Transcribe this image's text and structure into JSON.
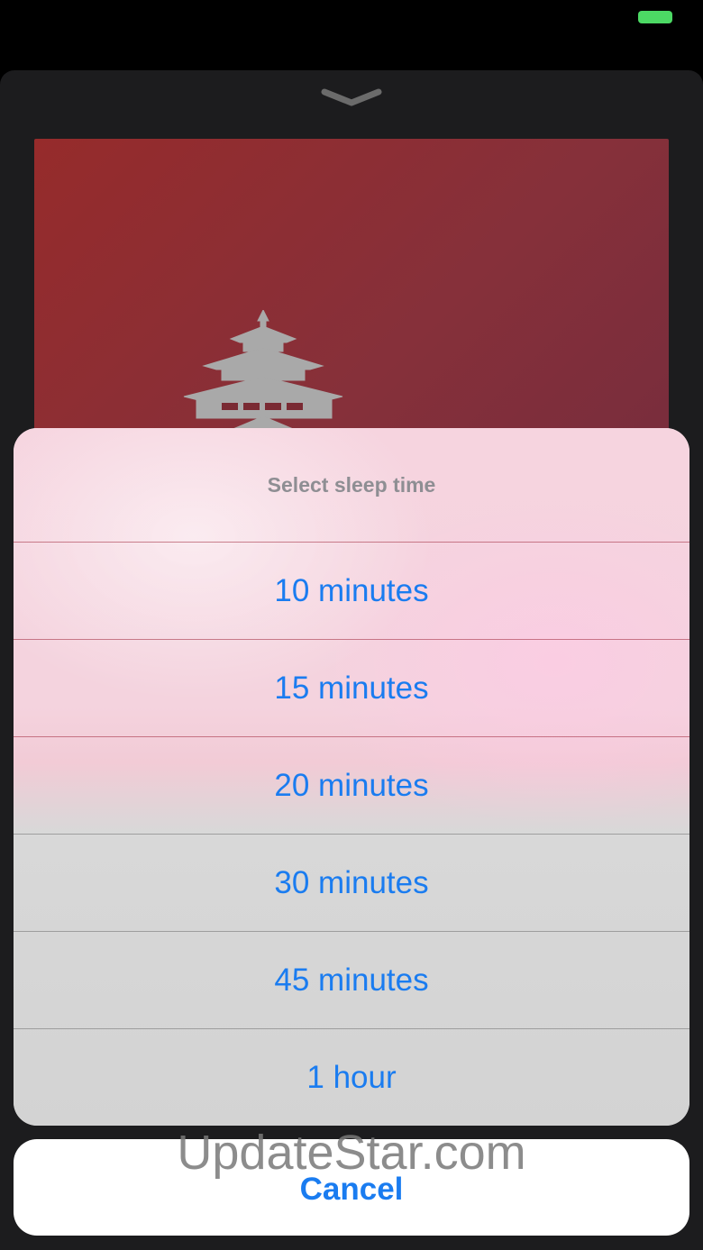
{
  "status_bar": {
    "battery_color": "#4cd964"
  },
  "player": {
    "grabber_icon": "chevron-down-icon",
    "artwork_icon": "pagoda-temple-icon",
    "artwork_colors": [
      "#962b2b",
      "#6d2a3e"
    ]
  },
  "action_sheet": {
    "title": "Select sleep time",
    "options": [
      {
        "label": "10 minutes"
      },
      {
        "label": "15 minutes"
      },
      {
        "label": "20 minutes"
      },
      {
        "label": "30 minutes"
      },
      {
        "label": "45 minutes"
      },
      {
        "label": "1 hour"
      }
    ],
    "cancel_label": "Cancel",
    "accent_color": "#1a7cf0"
  },
  "watermark": {
    "text": "UpdateStar.com"
  }
}
